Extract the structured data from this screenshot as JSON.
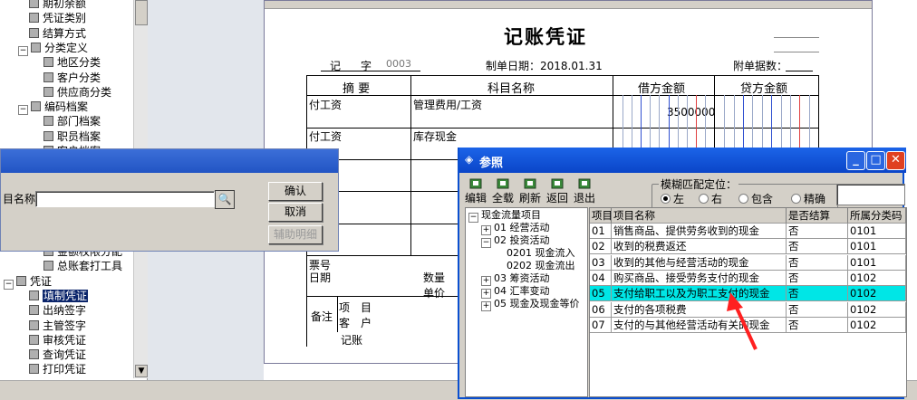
{
  "tree": {
    "items": [
      {
        "label": "期初余额",
        "level": 1,
        "toggle": ""
      },
      {
        "label": "凭证类别",
        "level": 1,
        "toggle": ""
      },
      {
        "label": "结算方式",
        "level": 1,
        "toggle": ""
      },
      {
        "label": "分类定义",
        "level": 1,
        "toggle": "−"
      },
      {
        "label": "地区分类",
        "level": 2,
        "toggle": ""
      },
      {
        "label": "客户分类",
        "level": 2,
        "toggle": ""
      },
      {
        "label": "供应商分类",
        "level": 2,
        "toggle": ""
      },
      {
        "label": "编码档案",
        "level": 1,
        "toggle": "−"
      },
      {
        "label": "部门档案",
        "level": 2,
        "toggle": ""
      },
      {
        "label": "职员档案",
        "level": 2,
        "toggle": ""
      },
      {
        "label": "客户档案",
        "level": 2,
        "toggle": ""
      }
    ],
    "lower_items": [
      {
        "label": "金额权限分配",
        "level": 2,
        "toggle": ""
      },
      {
        "label": "总账套打工具",
        "level": 2,
        "toggle": ""
      },
      {
        "label": "凭证",
        "level": 0,
        "toggle": "−"
      },
      {
        "label": "填制凭证",
        "level": 1,
        "toggle": "",
        "selected": true
      },
      {
        "label": "出纳签字",
        "level": 1,
        "toggle": ""
      },
      {
        "label": "主管签字",
        "level": 1,
        "toggle": ""
      },
      {
        "label": "审核凭证",
        "level": 1,
        "toggle": ""
      },
      {
        "label": "查询凭证",
        "level": 1,
        "toggle": ""
      },
      {
        "label": "打印凭证",
        "level": 1,
        "toggle": ""
      }
    ]
  },
  "voucher": {
    "title": "记账凭证",
    "type_char": "记",
    "zi": "字",
    "number": "0003",
    "date_label": "制单日期：2018.01.31",
    "attach_label": "附单据数：",
    "col_summary": "摘 要",
    "col_account": "科目名称",
    "col_debit": "借方金额",
    "col_credit": "贷方金额",
    "rows": [
      {
        "summary": "付工资",
        "account": "管理费用/工资",
        "debit": "3500000"
      },
      {
        "summary": "付工资",
        "account": "库存现金",
        "debit": ""
      }
    ],
    "ticket_no": "票号",
    "date": "日期",
    "qty": "数量",
    "unit_price": "单价",
    "remark": "备注",
    "project_a": "项",
    "project_b": "目",
    "customer_a": "客",
    "customer_b": "户",
    "bookkeep": "记账"
  },
  "query_dialog": {
    "field_label": "目名称",
    "field_value": "",
    "confirm": "确认",
    "cancel": "取消",
    "aux": "辅助明细"
  },
  "ref": {
    "title": "参照",
    "toolbar": [
      {
        "label": "编辑",
        "icon": "edit-icon"
      },
      {
        "label": "全载",
        "icon": "load-icon"
      },
      {
        "label": "刷新",
        "icon": "refresh-icon"
      },
      {
        "label": "返回",
        "icon": "return-icon"
      },
      {
        "label": "退出",
        "icon": "exit-icon"
      }
    ],
    "match_label": "模糊匹配定位：",
    "match_options": [
      "左",
      "右",
      "包含",
      "精确"
    ],
    "match_selected": 0,
    "tree": [
      {
        "label": "现金流量项目",
        "level": 0,
        "toggle": "−"
      },
      {
        "label": "01 经营活动",
        "level": 1,
        "toggle": "+"
      },
      {
        "label": "02 投资活动",
        "level": 1,
        "toggle": "−"
      },
      {
        "label": "0201 现金流入",
        "level": 2,
        "toggle": ""
      },
      {
        "label": "0202 现金流出",
        "level": 2,
        "toggle": ""
      },
      {
        "label": "03 筹资活动",
        "level": 1,
        "toggle": "+"
      },
      {
        "label": "04 汇率变动",
        "level": 1,
        "toggle": "+"
      },
      {
        "label": "05 现金及现金等价",
        "level": 1,
        "toggle": "+"
      }
    ],
    "grid_headers": [
      "项目",
      "项目名称",
      "是否结算",
      "所属分类码"
    ],
    "grid_rows": [
      [
        "01",
        "销售商品、提供劳务收到的现金",
        "否",
        "0101"
      ],
      [
        "02",
        "收到的税费返还",
        "否",
        "0101"
      ],
      [
        "03",
        "收到的其他与经营活动的现金",
        "否",
        "0101"
      ],
      [
        "04",
        "购买商品、接受劳务支付的现金",
        "否",
        "0102"
      ],
      [
        "05",
        "支付给职工以及为职工支付的现金",
        "否",
        "0102"
      ],
      [
        "06",
        "支付的各项税费",
        "否",
        "0102"
      ],
      [
        "07",
        "支付的与其他经营活动有关的现金",
        "否",
        "0102"
      ]
    ],
    "highlight_row": 4,
    "highlight_color": "#00e6e6",
    "arrow_color": "#ff2020"
  }
}
